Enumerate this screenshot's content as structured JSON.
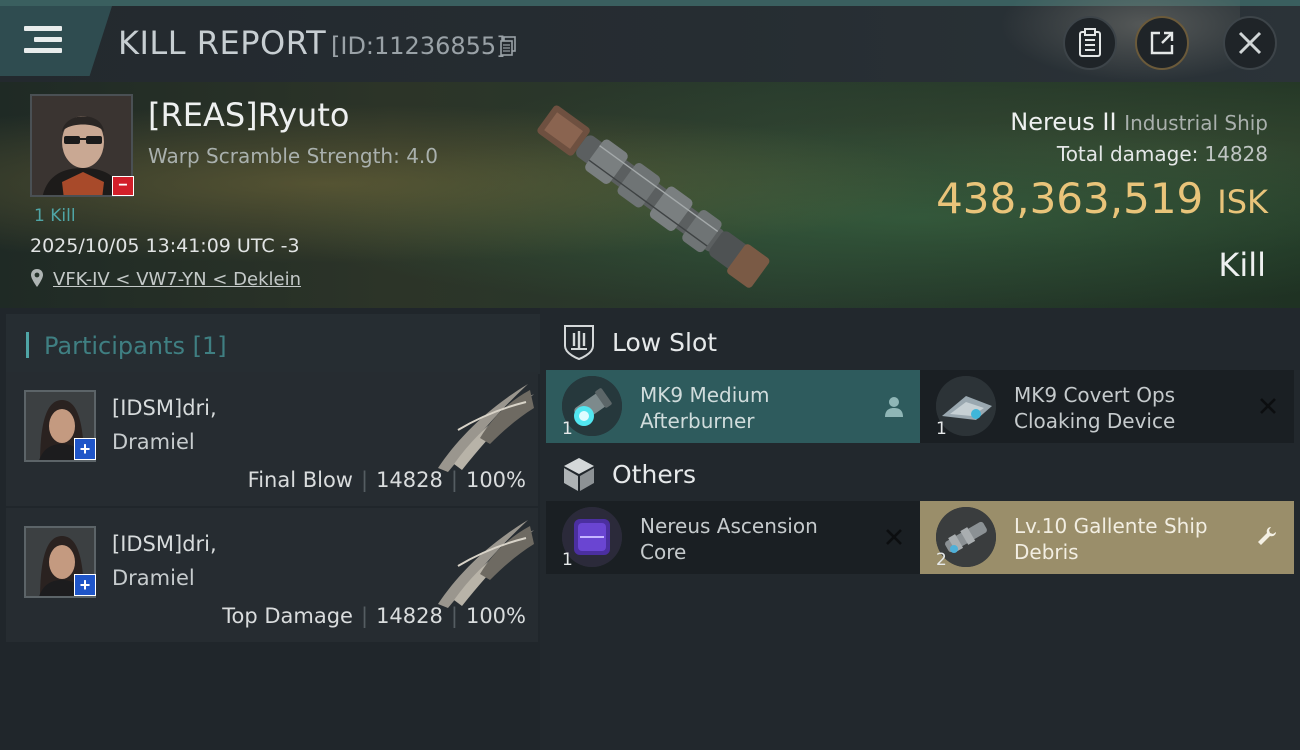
{
  "header": {
    "title": "KILL REPORT",
    "report_id": "[ID:11236855]"
  },
  "victim": {
    "name": "[REAS]Ryuto",
    "warp_scramble": "Warp Scramble Strength: 4.0",
    "kills": "1 Kill",
    "timestamp": "2025/10/05 13:41:09 UTC -3",
    "location": "VFK-IV < VW7-YN < Deklein",
    "ship_name": "Nereus II",
    "ship_class": "Industrial Ship",
    "total_damage_label": "Total damage:",
    "total_damage": "14828",
    "isk_value": "438,363,519",
    "isk_unit": "ISK",
    "result": "Kill"
  },
  "participants": {
    "title": "Participants [1]",
    "rows": [
      {
        "corp_name": "[IDSM]dri,",
        "name": "Dramiel",
        "role": "Final Blow",
        "damage": "14828",
        "percent": "100%"
      },
      {
        "corp_name": "[IDSM]dri,",
        "name": "Dramiel",
        "role": "Top Damage",
        "damage": "14828",
        "percent": "100%"
      }
    ]
  },
  "sections": {
    "low_slot": {
      "title": "Low Slot",
      "items": [
        {
          "name_line1": "MK9 Medium",
          "name_line2": "Afterburner",
          "qty": "1",
          "state": "dropped"
        },
        {
          "name_line1": "MK9 Covert Ops",
          "name_line2": "Cloaking Device",
          "qty": "1",
          "state": "destroyed"
        }
      ]
    },
    "others": {
      "title": "Others",
      "items": [
        {
          "name_line1": "Nereus Ascension",
          "name_line2": "Core",
          "qty": "1",
          "state": "destroyed"
        },
        {
          "name_line1": "Lv.10 Gallente Ship",
          "name_line2": "Debris",
          "qty": "2",
          "state": "salvage"
        }
      ]
    }
  },
  "colors": {
    "accent_teal": "#4fa5a6",
    "isk_gold": "#e9c47a",
    "dropped_item_bg": "#2e5b5d",
    "salvage_item_bg": "#9a8e6a",
    "kill_badge_red": "#d21f2a",
    "participant_badge_blue": "#1f55c8"
  },
  "icons": {
    "menu": "hamburger-menu-icon",
    "copy": "copy-icon",
    "clipboard": "clipboard-icon",
    "share": "share-icon",
    "close": "close-icon",
    "location": "map-pin-icon",
    "low_slot": "low-slot-icon",
    "others": "cube-icon",
    "pilot": "person-icon",
    "destroyed": "x-mark-icon",
    "salvage": "wrench-icon"
  }
}
